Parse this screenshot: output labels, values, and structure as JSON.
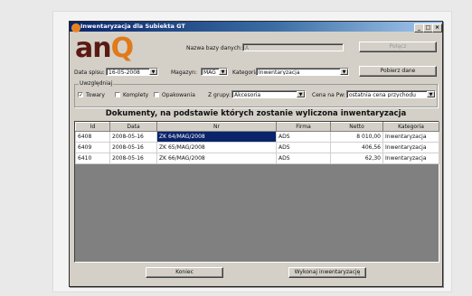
{
  "window": {
    "title": "Inwentaryzacja dla Subiekta GT",
    "minimize": "_",
    "maximize": "□",
    "close": "×"
  },
  "logo": {
    "part1": "an",
    "part2": "Q"
  },
  "top": {
    "db_label": "Nazwa bazy danych:",
    "db_value": "A",
    "connect_button": "Połącz"
  },
  "filters": {
    "date_label": "Data spisu:",
    "date_value": "16-05-2008",
    "warehouse_label": "Magazyn:",
    "warehouse_value": "MAG",
    "category_label": "Kategoria:",
    "category_value": "Inwentaryzacja",
    "fetch_button": "Pobierz dane"
  },
  "include": {
    "legend": "Uwzględniaj",
    "towary_label": "Towary",
    "towary_checked": true,
    "komplety_label": "Komplety",
    "komplety_checked": false,
    "opakowania_label": "Opakowania",
    "opakowania_checked": false,
    "group_label": "Z grupy:",
    "group_value": "Akcesoria",
    "price_label": "Cena na Pw:",
    "price_value": "ostatnia cena przychodu"
  },
  "heading": "Dokumenty, na podstawie których zostanie wyliczona inwentaryzacja",
  "table": {
    "columns": [
      "Id",
      "Data",
      "Nr",
      "Firma",
      "Netto",
      "Kategoria"
    ],
    "rows": [
      [
        "6408",
        "2008-05-16",
        "ZK 64/MAG/2008",
        "ADS",
        "8 010,00",
        "Inwentaryzacja"
      ],
      [
        "6409",
        "2008-05-16",
        "ZK 65/MAG/2008",
        "ADS",
        "406,56",
        "Inwentaryzacja"
      ],
      [
        "6410",
        "2008-05-16",
        "ZK 66/MAG/2008",
        "ADS",
        "62,30",
        "Inwentaryzacja"
      ]
    ]
  },
  "bottom": {
    "close_button": "Koniec",
    "run_button": "Wykonaj inwentaryzację"
  }
}
